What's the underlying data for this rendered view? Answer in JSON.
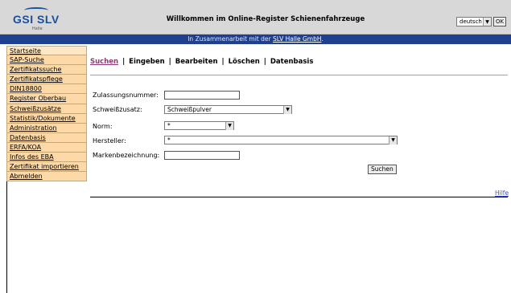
{
  "header": {
    "logo_text": "GSI SLV",
    "logo_sub": "Halle",
    "title": "Willkommen im Online-Register Schienenfahrzeuge",
    "language": {
      "selected": "deutsch",
      "ok_label": "OK"
    }
  },
  "banner": {
    "prefix": "In Zusammenarbeit mit der ",
    "link": "SLV Halle GmbH",
    "suffix": "."
  },
  "sidebar": {
    "items": [
      {
        "label": "Startseite"
      },
      {
        "label": "SAP-Suche"
      },
      {
        "label": "Zertifikatssuche"
      },
      {
        "label": "Zertifikatspflege"
      },
      {
        "label": "DIN18800"
      },
      {
        "label": "Register Oberbau"
      },
      {
        "label": "Schweißzusätze"
      },
      {
        "label": "Statistik/Dokumente"
      },
      {
        "label": "Administration"
      },
      {
        "label": "Datenbasis"
      },
      {
        "label": "ERFA/KOA"
      },
      {
        "label": "Infos des EBA"
      },
      {
        "label": "Zertifikat importieren"
      },
      {
        "label": "Abmelden"
      }
    ]
  },
  "tabs": {
    "search": "Suchen",
    "enter": "Eingeben",
    "edit": "Bearbeiten",
    "delete": "Löschen",
    "database": "Datenbasis",
    "separator": "|"
  },
  "form": {
    "approval_number": {
      "label": "Zulassungsnummer:",
      "value": ""
    },
    "welding_additive": {
      "label": "Schweißzusatz:",
      "value": "Schweißpulver"
    },
    "norm": {
      "label": "Norm:",
      "value": "*"
    },
    "manufacturer": {
      "label": "Hersteller:",
      "value": "*"
    },
    "brand_name": {
      "label": "Markenbezeichnung:",
      "value": ""
    },
    "search_button": "Suchen"
  },
  "help_link": "Hilfe",
  "colors": {
    "banner_bg": "#1f3f8f",
    "sidebar_bg": "#fcd9a6",
    "active_tab": "#8b3a74",
    "logo": "#1a4f9c"
  }
}
